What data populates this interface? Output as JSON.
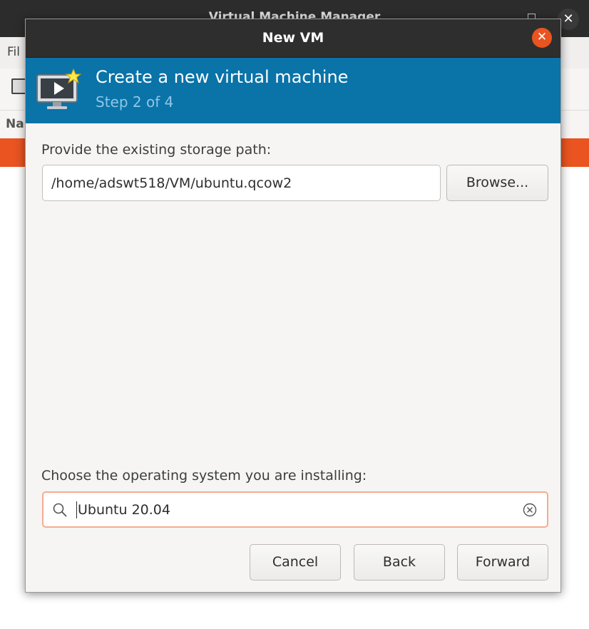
{
  "background_window": {
    "title": "Virtual Machine Manager",
    "menu_file": "Fil",
    "column_name": "Na"
  },
  "dialog": {
    "title": "New VM",
    "banner": {
      "title": "Create a new virtual machine",
      "step": "Step 2 of 4"
    },
    "storage": {
      "label": "Provide the existing storage path:",
      "value": "/home/adswt518/VM/ubuntu.qcow2",
      "browse_label": "Browse..."
    },
    "os": {
      "label": "Choose the operating system you are installing:",
      "value": "Ubuntu 20.04"
    },
    "buttons": {
      "cancel": "Cancel",
      "back": "Back",
      "forward": "Forward"
    }
  },
  "colors": {
    "banner": "#0a73a8",
    "accent": "#e95420",
    "titlebar": "#2e2e2e"
  },
  "icons": {
    "close": "close-icon",
    "vm": "vm-monitor-icon",
    "search": "search-icon",
    "clear": "clear-icon"
  }
}
